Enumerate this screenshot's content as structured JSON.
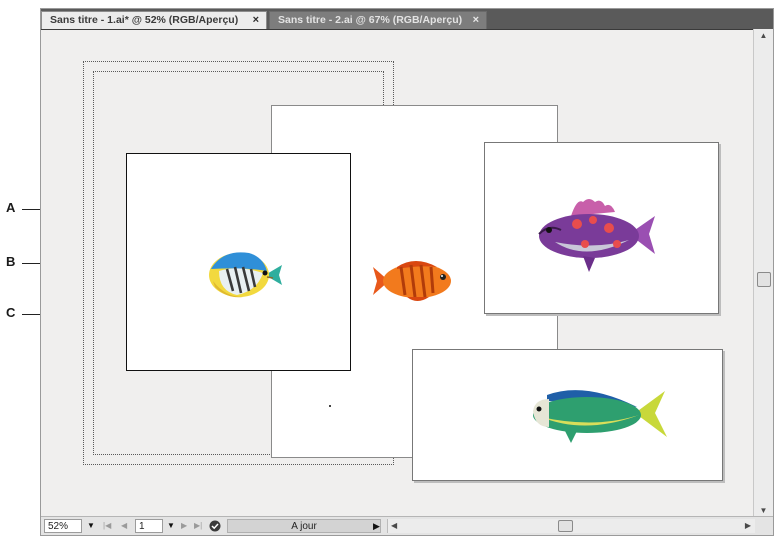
{
  "callouts": [
    {
      "letter": "A"
    },
    {
      "letter": "B"
    },
    {
      "letter": "C"
    }
  ],
  "tabs": [
    {
      "label": "Sans titre - 1.ai* @ 52% (RGB/Aperçu)",
      "active": true
    },
    {
      "label": "Sans titre - 2.ai @ 67% (RGB/Aperçu)",
      "active": false
    }
  ],
  "tab_close_glyph": "×",
  "statusbar": {
    "zoom": "52%",
    "artboard_number": "1",
    "status_text": "A jour"
  },
  "icons": {
    "close": "close-icon",
    "dropdown": "chevron-down-icon",
    "first": "first-artboard-icon",
    "previous": "previous-artboard-icon",
    "next": "next-artboard-icon",
    "last": "last-artboard-icon",
    "status": "status-check-icon",
    "status_menu": "status-menu-arrow-icon",
    "scroll_left": "scroll-left-arrow-icon",
    "scroll_right": "scroll-right-arrow-icon",
    "scroll_up": "scroll-up-arrow-icon",
    "scroll_down": "scroll-down-arrow-icon"
  },
  "colors": {
    "canvas": "#f0efee",
    "tabbar": "#5a5a5a",
    "active_tab": "#ececec",
    "artboard": "#ffffff"
  }
}
